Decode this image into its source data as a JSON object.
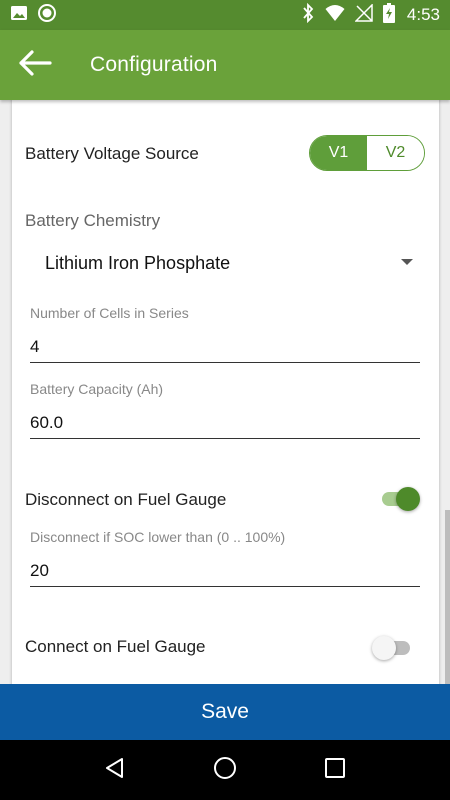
{
  "status_bar": {
    "time": "4:53",
    "icons": [
      "image-icon",
      "record-icon",
      "bluetooth-icon",
      "wifi-icon",
      "no-signal-icon",
      "battery-charging-icon"
    ]
  },
  "app_bar": {
    "title": "Configuration",
    "back_icon": "arrow-left-icon"
  },
  "form": {
    "voltage_source": {
      "label": "Battery Voltage Source",
      "options": [
        "V1",
        "V2"
      ],
      "selected": "V1"
    },
    "chemistry": {
      "label": "Battery Chemistry",
      "value": "Lithium Iron Phosphate"
    },
    "cells": {
      "label": "Number of Cells in Series",
      "value": "4"
    },
    "capacity": {
      "label": "Battery Capacity (Ah)",
      "value": "60.0"
    },
    "disconnect": {
      "label": "Disconnect on Fuel Gauge",
      "enabled": true
    },
    "soc_threshold": {
      "label": "Disconnect if SOC lower than (0 .. 100%)",
      "value": "20"
    },
    "connect": {
      "label": "Connect on Fuel Gauge",
      "enabled": false
    }
  },
  "save_label": "Save",
  "colors": {
    "app_bar": "#6aa23a",
    "status_bar": "#558b2f",
    "accent": "#5f9e3a",
    "save_bar": "#0c5ba3"
  },
  "nav": [
    "back-triangle-icon",
    "home-circle-icon",
    "recents-square-icon"
  ]
}
